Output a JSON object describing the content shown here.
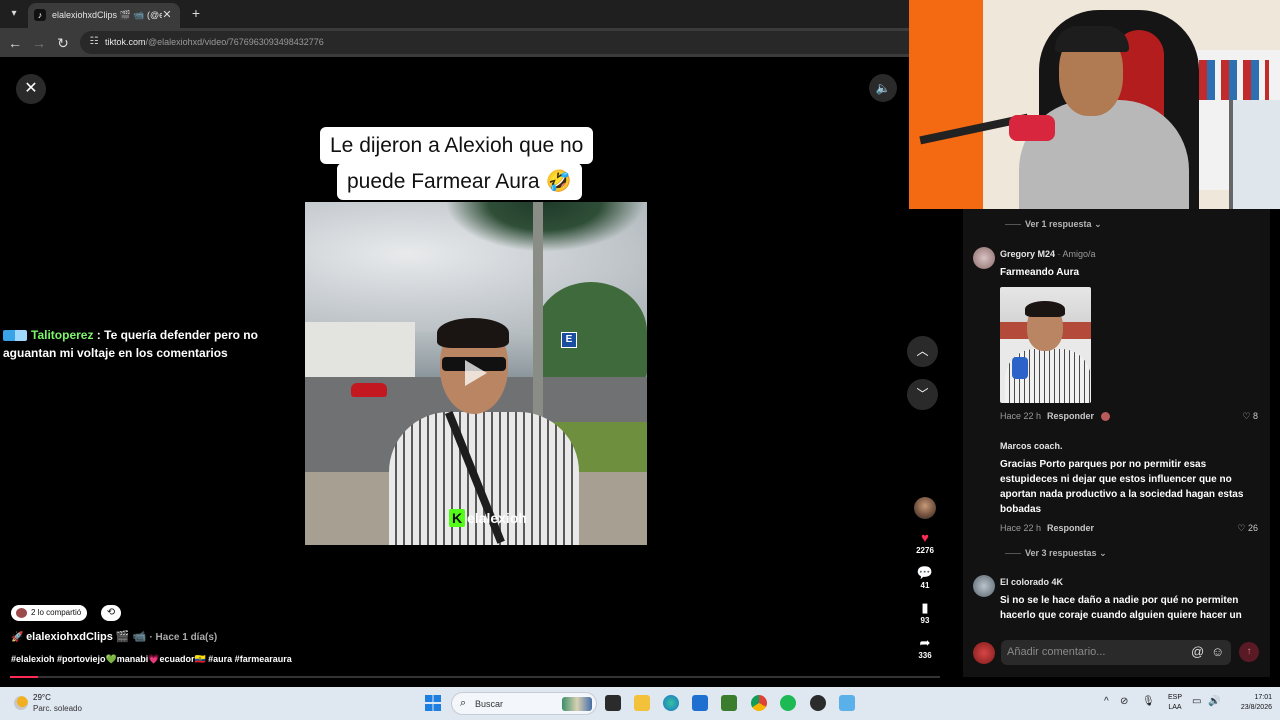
{
  "browser": {
    "tab_title": "elalexiohxdClips 🎬 📹 (@el",
    "url_host": "tiktok.com",
    "url_path": "/@elalexiohxd/video/7676963093498432776"
  },
  "video": {
    "caption_line_1": "Le dijeron a Alexioh que no",
    "caption_line_2": "puede Farmear Aura 🤣",
    "watermark_letter": "K",
    "watermark_text": "elalexioh",
    "progress": 0.03
  },
  "chat": {
    "username": "Talitoperez",
    "message": " : Te quería defender pero no aguantan mi voltaje en los comentarios"
  },
  "actions": {
    "likes": "2276",
    "comments": "41",
    "saves": "93",
    "shares": "336"
  },
  "post": {
    "shared_label": "2 lo compartió",
    "author": "elalexiohxdClips 🎬 📹",
    "date": "· Hace 1 día(s)",
    "hashtags": "#elalexioh #portoviejo💚manabi💗ecuador🇪🇨 #aura #farmearaura"
  },
  "comments": {
    "top_replies_toggle": "Ver 1 respuesta",
    "items": [
      {
        "name": "Gregory M24",
        "tag": "· Amigo/a",
        "text": "Farmeando Aura",
        "time": "Hace 22 h",
        "reply": "Responder",
        "likes": "8"
      },
      {
        "name": "Marcos coach.",
        "tag": "",
        "text": "Gracias Porto parques por no permitir esas estupideces ni dejar que estos influencer que no aportan nada productivo a la sociedad hagan estas bobadas",
        "time": "Hace 22 h",
        "reply": "Responder",
        "likes": "26",
        "replies_toggle": "Ver 3 respuestas"
      },
      {
        "name": "El colorado 4K",
        "tag": "",
        "text": "Si no se le hace daño a nadie por qué no permiten hacerlo que coraje cuando alguien quiere hacer un"
      }
    ],
    "input_placeholder": "Añadir comentario..."
  },
  "taskbar": {
    "temperature": "29°C",
    "weather": "Parc. soleado",
    "search_label": "Buscar",
    "lang_1": "ESP",
    "lang_2": "LAA",
    "time": "17:01",
    "date": "23/8/2026"
  },
  "colors": {
    "like": "#fe2c55",
    "kick_green": "#53fc18",
    "chat_user": "#7cf56a"
  }
}
